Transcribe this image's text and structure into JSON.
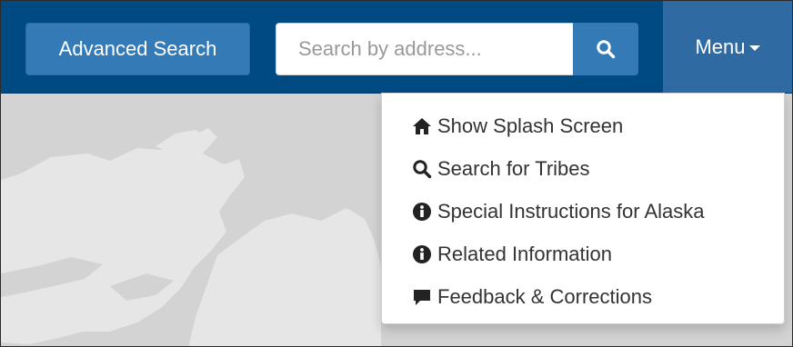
{
  "navbar": {
    "advanced_search_label": "Advanced Search",
    "search_placeholder": "Search by address...",
    "search_button_icon": "magnifier-icon",
    "menu_label": "Menu"
  },
  "menu": {
    "items": [
      {
        "icon": "home-icon",
        "label": "Show Splash Screen"
      },
      {
        "icon": "magnifier-icon",
        "label": "Search for Tribes"
      },
      {
        "icon": "info-circle-icon",
        "label": "Special Instructions for Alaska"
      },
      {
        "icon": "info-circle-icon",
        "label": "Related Information"
      },
      {
        "icon": "comment-icon",
        "label": "Feedback & Corrections"
      }
    ]
  },
  "colors": {
    "navbar": "#004a84",
    "button": "#337ab7",
    "menu_active": "#2f6aa3",
    "land": "#e6e6e6",
    "water": "#d3d3d3"
  }
}
